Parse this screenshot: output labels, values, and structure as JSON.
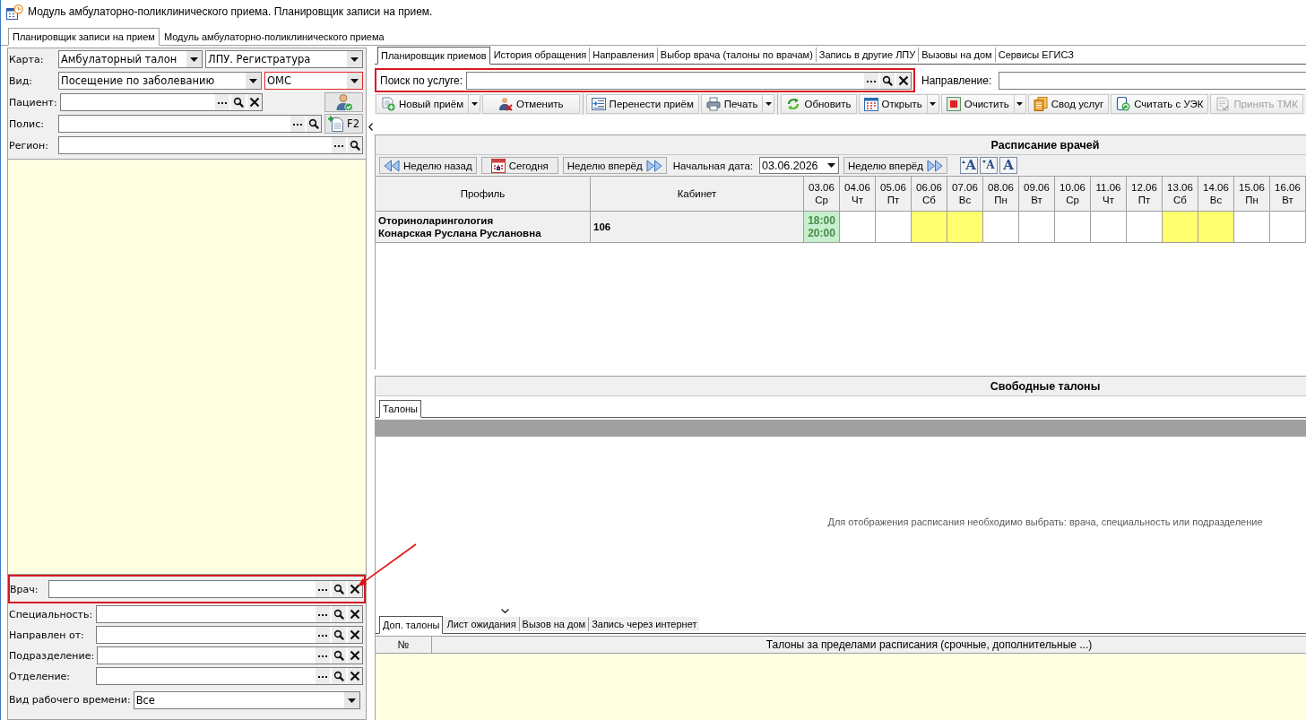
{
  "window": {
    "title": "Модуль амбулаторно-поликлинического приема. Планировщик записи на прием."
  },
  "main_tabs": [
    {
      "label": "Планировщик записи на прием",
      "selected": true
    },
    {
      "label": "Модуль амбулаторно-поликлинического приема",
      "selected": false
    }
  ],
  "left_panel": {
    "rows": [
      {
        "label": "Карта:",
        "controls": [
          {
            "kind": "combo",
            "value": "Амбулаторный талон",
            "highlighted": false
          },
          {
            "kind": "combo",
            "value": "ЛПУ. Регистратура",
            "highlighted": false
          }
        ]
      },
      {
        "label": "Вид:",
        "controls": [
          {
            "kind": "combo",
            "value": "Посещение по заболеванию",
            "highlighted": false
          },
          {
            "kind": "combo",
            "value": "ОМС",
            "highlighted": true
          }
        ]
      },
      {
        "label": "Пациент:",
        "controls": [
          {
            "kind": "lookup",
            "clearable": true
          },
          {
            "kind": "icon_button"
          }
        ]
      },
      {
        "label": "Полис:",
        "controls": [
          {
            "kind": "lookup",
            "clearable": false
          },
          {
            "kind": "button",
            "label": "F2"
          }
        ]
      },
      {
        "label": "Регион:",
        "controls": [
          {
            "kind": "lookup",
            "clearable": false
          }
        ]
      }
    ],
    "filters": [
      {
        "label": "Врач:",
        "kind": "lookup",
        "clearable": true,
        "highlighted": true,
        "arrow": true
      },
      {
        "label": "Специальность:",
        "kind": "lookup",
        "clearable": true,
        "highlighted": false,
        "arrow": false
      },
      {
        "label": "Направлен от:",
        "kind": "lookup",
        "clearable": true,
        "highlighted": false,
        "arrow": false
      },
      {
        "label": "Подразделение:",
        "kind": "lookup",
        "clearable": true,
        "highlighted": false,
        "arrow": false
      },
      {
        "label": "Отделение:",
        "kind": "lookup",
        "clearable": true,
        "highlighted": false,
        "arrow": false
      },
      {
        "label": "Вид рабочего времени:",
        "kind": "combo",
        "value": "Все",
        "highlighted": false,
        "arrow": false
      }
    ]
  },
  "right_panel": {
    "tabs": [
      {
        "label": "Планировщик приемов",
        "selected": true
      },
      {
        "label": "История обращения",
        "selected": false
      },
      {
        "label": "Направления",
        "selected": false
      },
      {
        "label": "Выбор врача (талоны по врачам)",
        "selected": false
      },
      {
        "label": "Запись в другие ЛПУ",
        "selected": false
      },
      {
        "label": "Вызовы на дом",
        "selected": false
      },
      {
        "label": "Сервисы ЕГИСЗ",
        "selected": false
      }
    ],
    "service_search": {
      "label": "Поиск по услуге:",
      "highlighted": true,
      "clearable": true
    },
    "direction": {
      "label": "Направление:"
    },
    "toolbar": [
      {
        "buttons": [
          {
            "label": "Новый приём",
            "dropdown": true,
            "disabled": false
          },
          {
            "label": "Отменить",
            "dropdown": false,
            "disabled": false
          }
        ]
      },
      {
        "buttons": [
          {
            "label": "Перенести приём",
            "dropdown": false,
            "disabled": false
          },
          {
            "label": "Печать",
            "dropdown": true,
            "disabled": false
          }
        ]
      },
      {
        "buttons": [
          {
            "label": "Обновить",
            "dropdown": false,
            "disabled": false
          },
          {
            "label": "Открыть",
            "dropdown": true,
            "disabled": false
          },
          {
            "label": "Очистить",
            "dropdown": true,
            "disabled": false
          },
          {
            "label": "Свод услуг",
            "dropdown": false,
            "disabled": false
          },
          {
            "label": "Считать с УЭК",
            "dropdown": false,
            "disabled": false
          },
          {
            "label": "Принять ТМК",
            "dropdown": false,
            "disabled": true
          }
        ]
      }
    ],
    "schedule": {
      "title": "Расписание врачей",
      "nav": [
        {
          "kind": "back",
          "label": "Неделю назад"
        },
        {
          "kind": "today",
          "label": "Сегодня"
        },
        {
          "kind": "forward",
          "label": "Неделю вперёд"
        },
        {
          "kind": "date_label",
          "label": "Начальная дата:"
        },
        {
          "kind": "date",
          "value": "03.06.2026"
        },
        {
          "kind": "forward",
          "label": "Неделю вперёд"
        }
      ],
      "font_buttons": [
        {
          "kind": "increase",
          "label": "A"
        },
        {
          "kind": "decrease",
          "label": "A"
        },
        {
          "kind": "reset",
          "label": "A"
        }
      ],
      "columns": [
        "Профиль",
        "Кабинет"
      ],
      "days": [
        {
          "date": "03.06",
          "weekday": "Ср",
          "weekend": false
        },
        {
          "date": "04.06",
          "weekday": "Чт",
          "weekend": false
        },
        {
          "date": "05.06",
          "weekday": "Пт",
          "weekend": false
        },
        {
          "date": "06.06",
          "weekday": "Сб",
          "weekend": true
        },
        {
          "date": "07.06",
          "weekday": "Вс",
          "weekend": true
        },
        {
          "date": "08.06",
          "weekday": "Пн",
          "weekend": false
        },
        {
          "date": "09.06",
          "weekday": "Вт",
          "weekend": false
        },
        {
          "date": "10.06",
          "weekday": "Ср",
          "weekend": false
        },
        {
          "date": "11.06",
          "weekday": "Чт",
          "weekend": false
        },
        {
          "date": "12.06",
          "weekday": "Пт",
          "weekend": false
        },
        {
          "date": "13.06",
          "weekday": "Сб",
          "weekend": true
        },
        {
          "date": "14.06",
          "weekday": "Вс",
          "weekend": true
        },
        {
          "date": "15.06",
          "weekday": "Пн",
          "weekend": false
        },
        {
          "date": "16.06",
          "weekday": "Вт",
          "weekend": false
        }
      ],
      "rows": [
        {
          "profile": "Оториноларингология",
          "doctor": "Конарская Руслана Руслановна",
          "cabinet": "106",
          "cells": [
            {
              "kind": "reception",
              "times": [
                "18:00",
                "20:00"
              ]
            },
            {
              "kind": "empty"
            },
            {
              "kind": "empty"
            },
            {
              "kind": "empty"
            },
            {
              "kind": "empty"
            },
            {
              "kind": "empty"
            },
            {
              "kind": "empty"
            },
            {
              "kind": "empty"
            },
            {
              "kind": "empty"
            },
            {
              "kind": "empty"
            },
            {
              "kind": "empty"
            },
            {
              "kind": "empty"
            },
            {
              "kind": "empty"
            },
            {
              "kind": "empty"
            }
          ]
        }
      ]
    },
    "free_slots": {
      "title": "Свободные талоны",
      "tabs": [
        {
          "label": "Талоны",
          "selected": true
        }
      ],
      "message": "Для отображения расписания необходимо выбрать: врача, специальность или подразделение"
    },
    "extra_slots": {
      "tabs": [
        {
          "label": "Доп. талоны",
          "selected": true
        },
        {
          "label": "Лист ожидания",
          "selected": false
        },
        {
          "label": "Вызов на дом",
          "selected": false
        },
        {
          "label": "Запись через интернет",
          "selected": false
        }
      ],
      "columns": [
        "№",
        "Талоны за пределами расписания (срочные, дополнительные ...)"
      ]
    }
  }
}
